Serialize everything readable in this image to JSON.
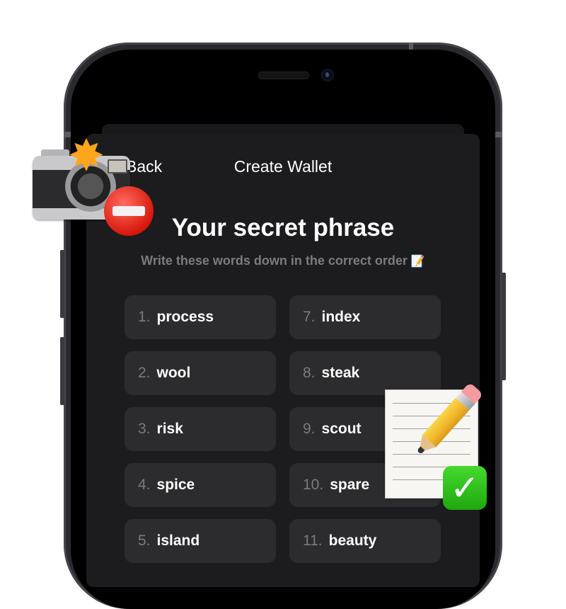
{
  "header": {
    "back_label": "Back",
    "title": "Create Wallet"
  },
  "main": {
    "title": "Your secret phrase",
    "subtitle": "Write these words down in the correct order",
    "subtitle_emoji": "📝"
  },
  "words": [
    {
      "num": "1.",
      "word": "process"
    },
    {
      "num": "7.",
      "word": "index"
    },
    {
      "num": "2.",
      "word": "wool"
    },
    {
      "num": "8.",
      "word": "steak"
    },
    {
      "num": "3.",
      "word": "risk"
    },
    {
      "num": "9.",
      "word": "scout"
    },
    {
      "num": "4.",
      "word": "spice"
    },
    {
      "num": "10.",
      "word": "spare"
    },
    {
      "num": "5.",
      "word": "island"
    },
    {
      "num": "11.",
      "word": "beauty"
    }
  ],
  "overlays": {
    "screenshot_blocked": {
      "icons": [
        "camera-with-flash",
        "no-entry"
      ]
    },
    "write_down_ok": {
      "icons": [
        "memo",
        "white-check-mark"
      ],
      "check_glyph": "✓",
      "flash_glyph": "✸"
    }
  },
  "colors": {
    "sheet_bg": "#1c1c1e",
    "card_bg": "#2c2c2e",
    "muted_text": "#7b7b80",
    "text": "#ffffff"
  }
}
